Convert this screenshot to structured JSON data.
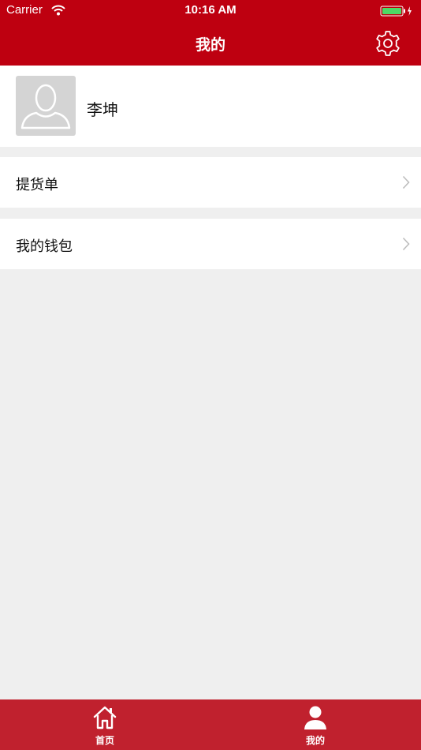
{
  "status_bar": {
    "carrier": "Carrier",
    "time": "10:16 AM"
  },
  "nav": {
    "title": "我的",
    "settings_icon": "gear-icon"
  },
  "profile": {
    "name": "李坤",
    "avatar_icon": "default-avatar-icon"
  },
  "menu": {
    "items": [
      {
        "label": "提货单"
      },
      {
        "label": "我的钱包"
      }
    ]
  },
  "tabs": [
    {
      "label": "首页",
      "icon": "home-icon"
    },
    {
      "label": "我的",
      "icon": "user-icon"
    }
  ],
  "colors": {
    "brand_red": "#be0010",
    "tab_bar_red": "#c0212e",
    "page_background": "#efefef",
    "battery_green": "#4cd964"
  }
}
